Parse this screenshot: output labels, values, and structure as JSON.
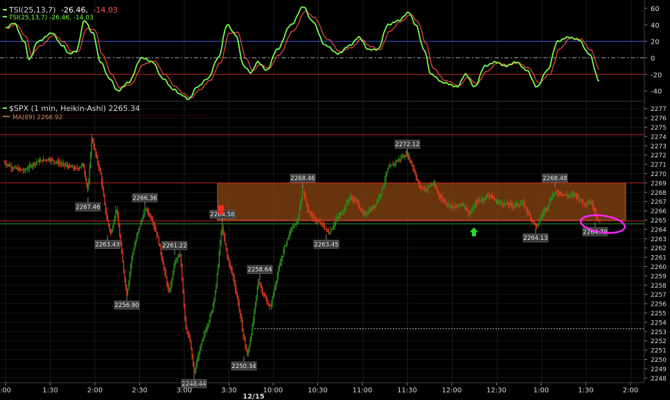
{
  "colors": {
    "background": "#000000",
    "grid": "#1c1c1c",
    "axis_text": "#dcdcdc",
    "tsi_line": "#7cff4a",
    "tsi_signal": "#ff4a4a",
    "ma_line": "#8a6a3a",
    "bull_candle": "#2a8f1a",
    "bear_candle": "#e03a20",
    "zone_fill": "#8b4513",
    "zone_border": "#c06030",
    "red_line": "#c02020",
    "green_line": "#2aa02a",
    "blue_line": "#4a5ad8",
    "callout_bg": "#3a3a3a",
    "callout_text": "#e8e8e8",
    "magenta_circle": "#ff22ff",
    "up_arrow": "#22dd22",
    "down_marker": "#ff2a1a"
  },
  "tsi_panel": {
    "legend1": "TSI(25,13,7) -26.46, -14.03",
    "legend1_name": "TSI(25,13,7)",
    "legend1_v1": "-26.46",
    "legend1_v2": "-14.03",
    "legend2": "TSI(25,13,7) -26.46, -14.03",
    "yticks": [
      "60",
      "40",
      "20",
      "0",
      "-20",
      "-40"
    ]
  },
  "price_panel": {
    "legend_title": "$SPX (1 min, Heikin-Ashi) 2265.34",
    "legend_ma": "MA(89) 2266.92",
    "date_label": "12/15"
  },
  "chart_data": [
    {
      "type": "line",
      "name_panel": "TSI indicator",
      "series": [
        {
          "name": "TSI(25,13,7)",
          "role": "tsi",
          "x": [
            "8:00",
            "8:30",
            "9:00",
            "9:30",
            "10:00",
            "10:30",
            "11:00",
            "11:30",
            "12:00",
            "12:30",
            "13:00",
            "13:30",
            "13:45"
          ],
          "values": [
            45,
            10,
            35,
            -35,
            10,
            -50,
            60,
            5,
            60,
            -30,
            -5,
            20,
            -28
          ]
        },
        {
          "name": "TSI(25,13,7) signal",
          "role": "signal",
          "values": [
            42,
            14,
            30,
            -28,
            6,
            -42,
            55,
            10,
            55,
            -25,
            -8,
            22,
            -14
          ]
        }
      ],
      "ylim": [
        -50,
        65
      ],
      "hlines": [
        20,
        0,
        -20
      ]
    },
    {
      "type": "candlestick",
      "title": "$SPX (1 min, Heikin-Ashi) 2265.34",
      "xlim": [
        "0:00 label",
        "2:00"
      ],
      "x_ticks": [
        ":00",
        "1:30",
        "2:00",
        "2:30",
        "3:00",
        "3:30",
        "10:00",
        "10:30",
        "11:00",
        "11:30",
        "12:00",
        "12:30",
        "1:00",
        "1:30",
        "2:00"
      ],
      "y_ticks": [
        2277,
        2276,
        2275,
        2274,
        2273,
        2272,
        2271,
        2270,
        2269,
        2268,
        2267,
        2266,
        2265,
        2264,
        2263,
        2262,
        2261,
        2260,
        2259,
        2258,
        2257,
        2256,
        2255,
        2254,
        2253,
        2252,
        2251,
        2250,
        2249,
        2248
      ],
      "ylim": [
        2247.5,
        2277.5
      ],
      "annotations": [
        {
          "label": "2267.46",
          "value": 2267.46
        },
        {
          "label": "2263.43",
          "value": 2263.43
        },
        {
          "label": "2266.36",
          "value": 2266.36
        },
        {
          "label": "2256.90",
          "value": 2256.9
        },
        {
          "label": "2261.22",
          "value": 2261.22
        },
        {
          "label": "2248.44",
          "value": 2248.44
        },
        {
          "label": "2264.58",
          "value": 2264.58
        },
        {
          "label": "2258.64",
          "value": 2258.64
        },
        {
          "label": "2250.34",
          "value": 2250.34
        },
        {
          "label": "2268.46",
          "value": 2268.46
        },
        {
          "label": "2263.45",
          "value": 2263.45
        },
        {
          "label": "2272.12",
          "value": 2272.12
        },
        {
          "label": "2264.13",
          "value": 2264.13
        },
        {
          "label": "2268.48",
          "value": 2268.48
        },
        {
          "label": "2264.79",
          "value": 2264.79
        }
      ],
      "horizontal_lines": [
        {
          "value": 2274.2,
          "color": "red"
        },
        {
          "value": 2269.0,
          "color": "red"
        },
        {
          "value": 2264.9,
          "color": "red"
        },
        {
          "value": 2264.6,
          "color": "green"
        },
        {
          "value": 2253.3,
          "color": "dotted"
        }
      ],
      "zone": {
        "low": 2265.0,
        "high": 2269.0
      },
      "ma": {
        "name": "MA(89)",
        "last": 2266.92
      },
      "path": [
        {
          "t": "8:00",
          "p": 2271.3
        },
        {
          "t": "8:30",
          "p": 2270.7
        },
        {
          "t": "9:00",
          "p": 2272.0
        },
        {
          "t": "9:15",
          "p": 2270.5
        },
        {
          "t": "9:25",
          "p": 2267.5
        },
        {
          "t": "9:30",
          "p": 2273.8
        },
        {
          "t": "9:40",
          "p": 2270.0
        },
        {
          "t": "9:50",
          "p": 2263.4
        },
        {
          "t": "10:00",
          "p": 2266.5
        },
        {
          "t": "10:10",
          "p": 2256.9
        },
        {
          "t": "10:20",
          "p": 2266.3
        },
        {
          "t": "10:40",
          "p": 2261.2
        },
        {
          "t": "10:55",
          "p": 2258.0
        },
        {
          "t": "11:05",
          "p": 2255.0
        },
        {
          "t": "11:15",
          "p": 2248.4
        },
        {
          "t": "11:35",
          "p": 2255.0
        },
        {
          "t": "11:45",
          "p": 2257.0
        },
        {
          "t": "11:55",
          "p": 2264.5
        },
        {
          "t": "12:10",
          "p": 2260.0
        },
        {
          "t": "12:20",
          "p": 2256.0
        },
        {
          "t": "12:30",
          "p": 2250.3
        },
        {
          "t": "12:40",
          "p": 2258.6
        },
        {
          "t": "12:50",
          "p": 2256.0
        },
        {
          "t": "13:10",
          "p": 2264.0
        },
        {
          "t": "13:25",
          "p": 2268.4
        },
        {
          "t": "13:45",
          "p": 2265.0
        },
        {
          "t": "14:00",
          "p": 2263.5
        },
        {
          "t": "14:20",
          "p": 2267.5
        },
        {
          "t": "14:40",
          "p": 2266.0
        },
        {
          "t": "15:00",
          "p": 2267.0
        },
        {
          "t": "15:20",
          "p": 2271.5
        },
        {
          "t": "15:35",
          "p": 2272.1
        },
        {
          "t": "15:50",
          "p": 2268.5
        },
        {
          "t": "16:05",
          "p": 2269.0
        },
        {
          "t": "16:20",
          "p": 2266.5
        },
        {
          "t": "16:35",
          "p": 2265.5
        },
        {
          "t": "16:50",
          "p": 2267.5
        },
        {
          "t": "17:10",
          "p": 2266.5
        },
        {
          "t": "17:25",
          "p": 2264.1
        },
        {
          "t": "17:40",
          "p": 2268.5
        },
        {
          "t": "17:55",
          "p": 2267.5
        },
        {
          "t": "18:05",
          "p": 2266.5
        }
      ]
    }
  ]
}
